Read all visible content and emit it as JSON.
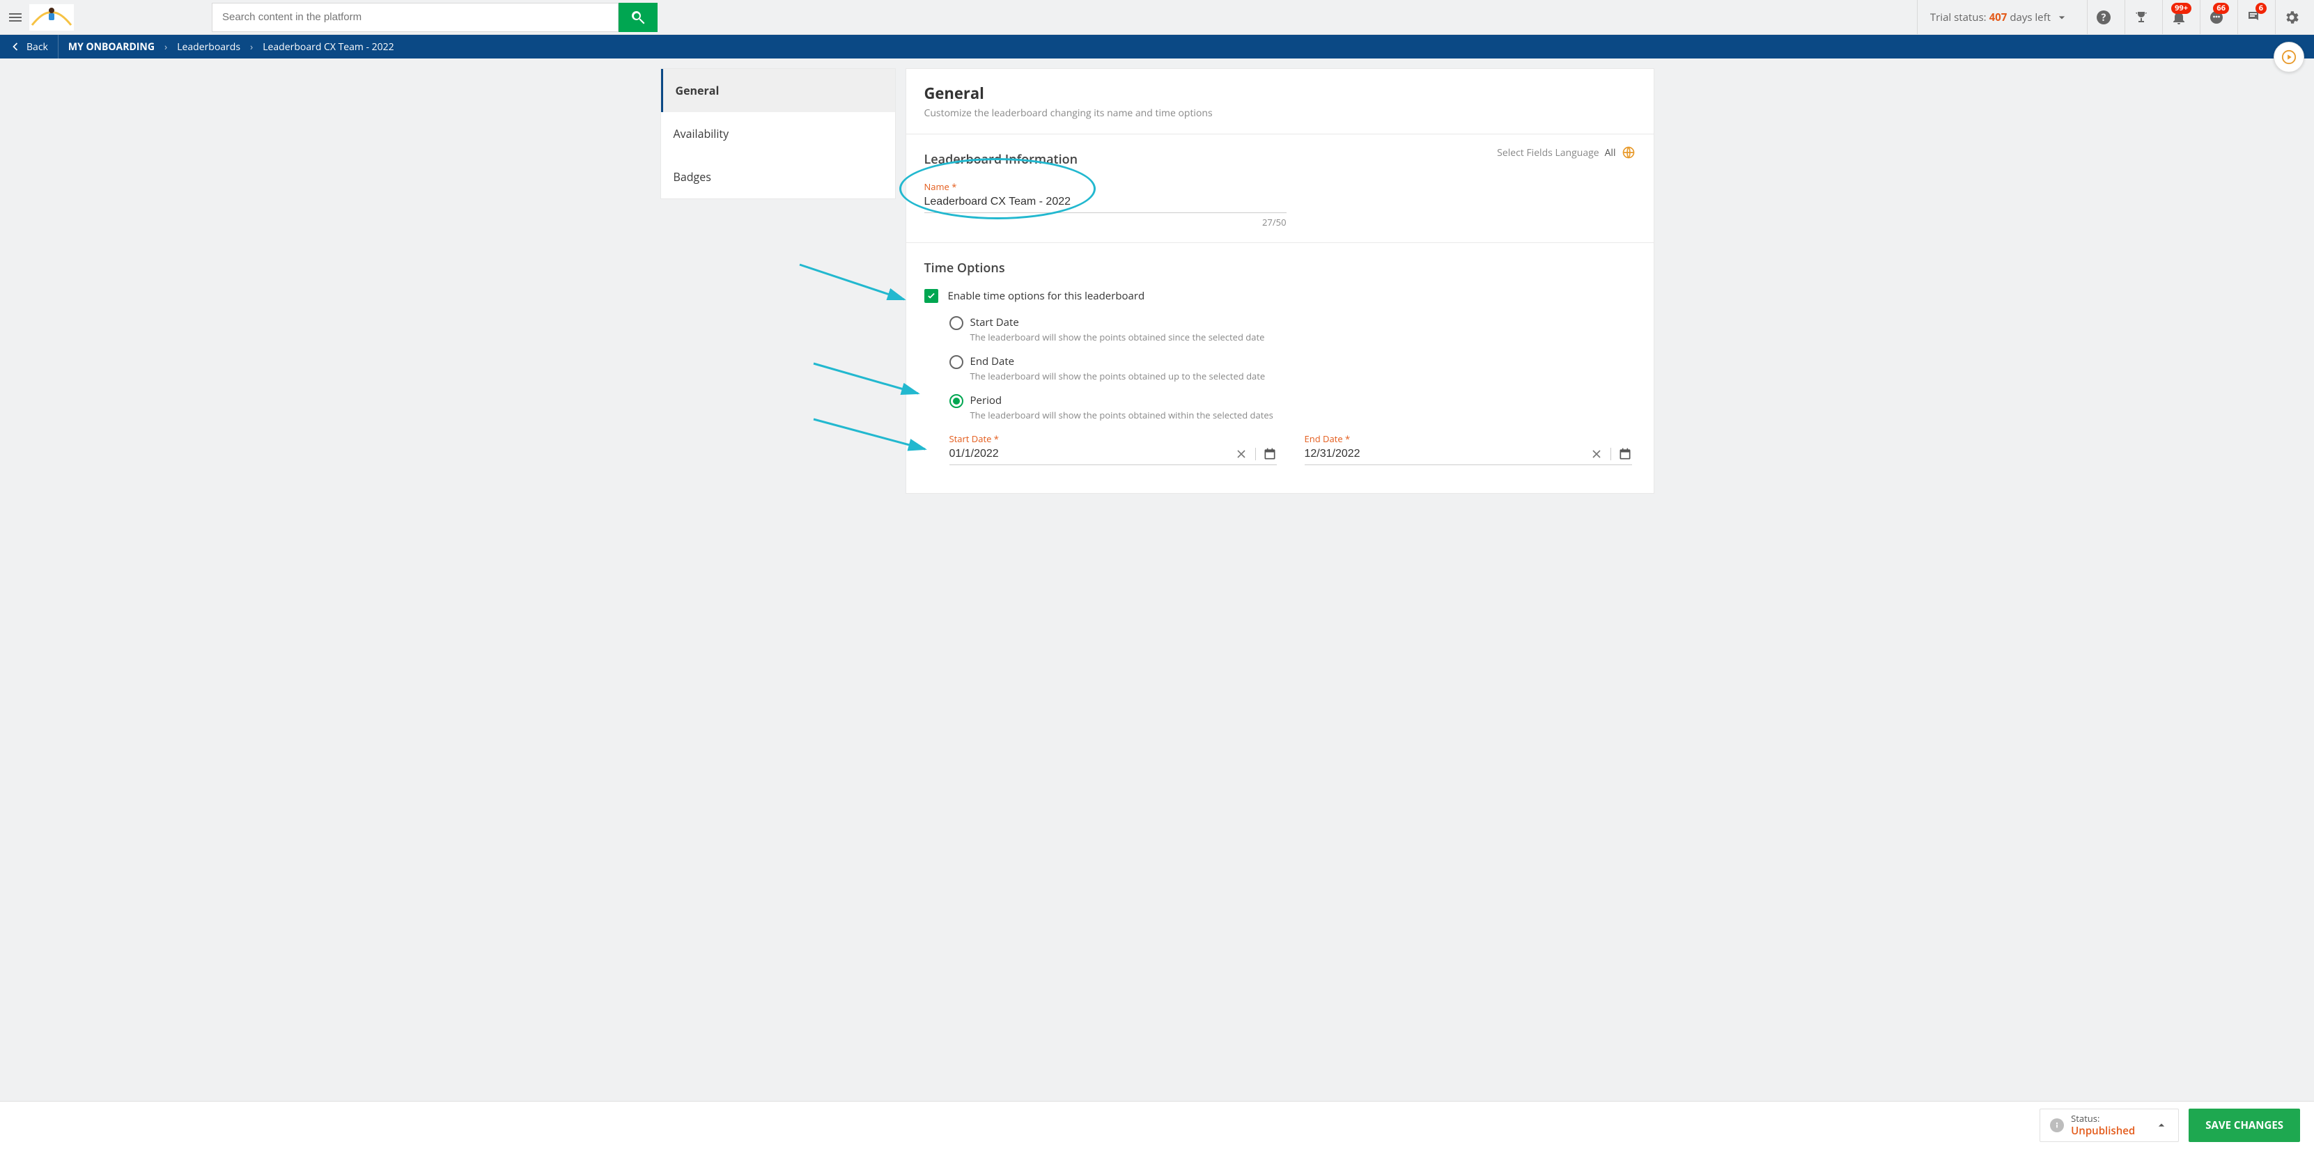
{
  "header": {
    "search_placeholder": "Search content in the platform",
    "trial_prefix": "Trial status:",
    "trial_days": "407",
    "trial_suffix": "days left",
    "badges": {
      "notifications": "99+",
      "chat": "66",
      "activity": "6"
    }
  },
  "breadcrumb": {
    "back": "Back",
    "app": "MY ONBOARDING",
    "section": "Leaderboards",
    "page": "Leaderboard CX Team - 2022"
  },
  "tabs": {
    "general": "General",
    "availability": "Availability",
    "badges": "Badges"
  },
  "general": {
    "title": "General",
    "subtitle": "Customize the leaderboard changing its name and time options",
    "info_header": "Leaderboard Information",
    "lang_label": "Select Fields Language",
    "lang_value": "All",
    "name_label": "Name *",
    "name_value": "Leaderboard CX Team - 2022",
    "name_counter": "27/50"
  },
  "time_options": {
    "title": "Time Options",
    "enable_label": "Enable time options for this leaderboard",
    "enabled": true,
    "selected": "period",
    "modes": {
      "start": {
        "label": "Start Date",
        "desc": "The leaderboard will show the points obtained since the selected date"
      },
      "end": {
        "label": "End Date",
        "desc": "The leaderboard will show the points obtained up to the selected date"
      },
      "period": {
        "label": "Period",
        "desc": "The leaderboard will show the points obtained within the selected dates"
      }
    },
    "start_date": {
      "label": "Start Date *",
      "value": "01/1/2022"
    },
    "end_date": {
      "label": "End Date *",
      "value": "12/31/2022"
    }
  },
  "footer": {
    "status_label": "Status:",
    "status_value": "Unpublished",
    "save": "SAVE CHANGES"
  }
}
